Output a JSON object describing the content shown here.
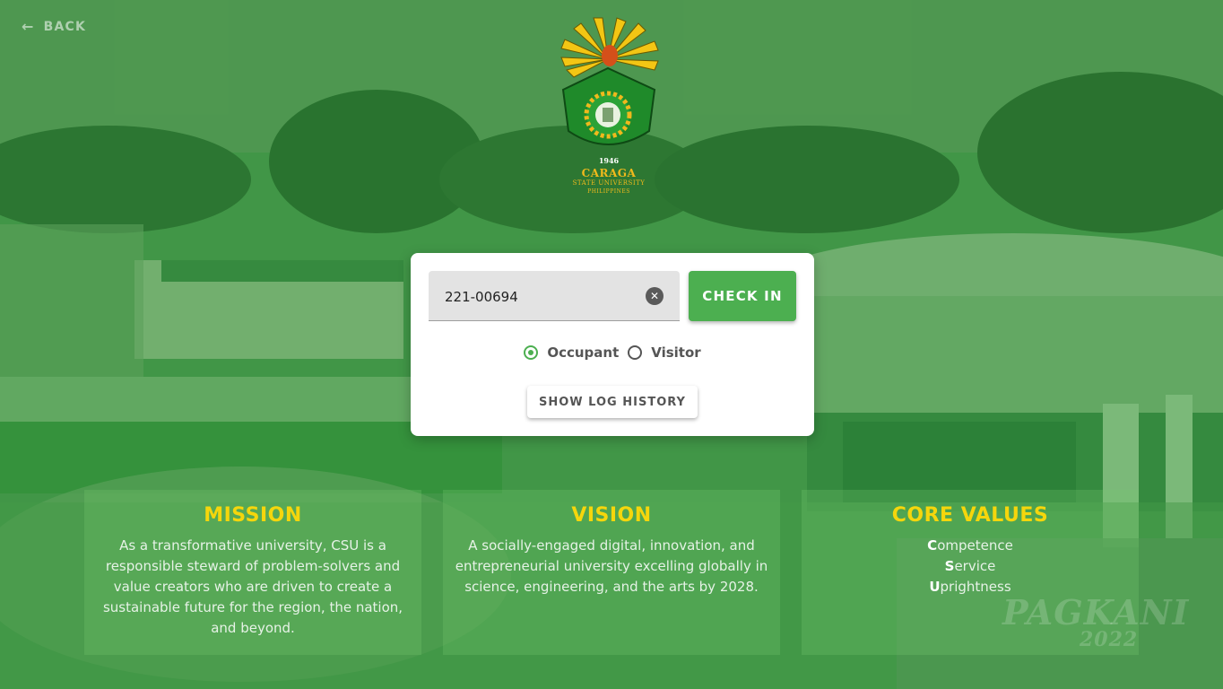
{
  "nav": {
    "back_label": "BACK",
    "back_icon": "arrow-left-icon"
  },
  "logo": {
    "year": "1946",
    "name": "CARAGA",
    "subtitle": "STATE UNIVERSITY",
    "country": "PHILIPPINES"
  },
  "checkin": {
    "id_value": "221-00694",
    "clear_icon": "close-circle-icon",
    "button_label": "CHECK IN",
    "options": [
      {
        "label": "Occupant",
        "selected": true
      },
      {
        "label": "Visitor",
        "selected": false
      }
    ],
    "log_button_label": "SHOW LOG HISTORY"
  },
  "panels": {
    "mission": {
      "title": "MISSION",
      "text": "As a transformative university, CSU is a responsible steward of problem-solvers and value creators who are driven to create a sustainable future for the region, the nation, and beyond."
    },
    "vision": {
      "title": "VISION",
      "text": "A socially-engaged digital, innovation, and entrepreneurial university excelling globally in science, engineering, and the arts by 2028."
    },
    "core_values": {
      "title": "CORE VALUES",
      "items": [
        {
          "initial": "C",
          "rest": "ompetence"
        },
        {
          "initial": "S",
          "rest": "ervice"
        },
        {
          "initial": "U",
          "rest": "prightness"
        }
      ]
    }
  },
  "watermark": {
    "text": "PAGKANI",
    "year": "2022"
  },
  "colors": {
    "accent_green": "#4caf50",
    "heading_yellow": "#f5d60c",
    "logo_gold": "#f0b91c"
  }
}
